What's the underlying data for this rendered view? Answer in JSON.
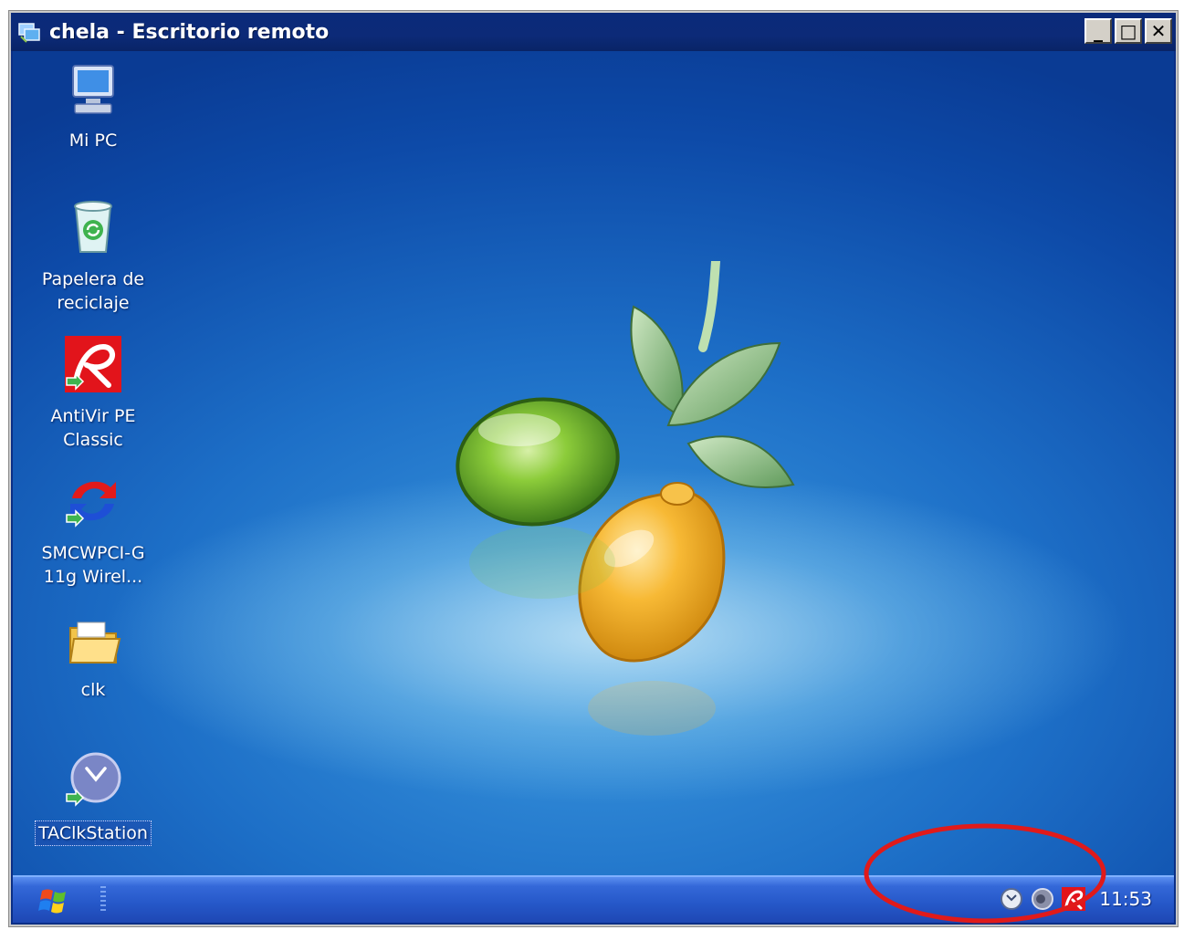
{
  "window": {
    "title": "chela - Escritorio remoto",
    "controls": {
      "minimize": "_",
      "maximize": "□",
      "close": "✕"
    }
  },
  "desktop": {
    "icons": [
      {
        "label_line1": "Mi PC",
        "label_line2": "",
        "icon": "my-computer-icon"
      },
      {
        "label_line1": "Papelera de",
        "label_line2": "reciclaje",
        "icon": "recycle-bin-icon"
      },
      {
        "label_line1": "AntiVir PE",
        "label_line2": "Classic",
        "icon": "antivir-icon"
      },
      {
        "label_line1": "SMCWPCI-G",
        "label_line2": "11g Wirel...",
        "icon": "wireless-adapter-icon"
      },
      {
        "label_line1": "clk",
        "label_line2": "",
        "icon": "folder-icon"
      },
      {
        "label_line1": "TAClkStation",
        "label_line2": "",
        "icon": "taclkstation-icon"
      }
    ],
    "wallpaper": "lemon-and-lime-wallpaper"
  },
  "taskbar": {
    "start_icon": "windows-logo-icon",
    "tray_icons": [
      "clock-service-icon",
      "speaker-icon",
      "antivir-tray-icon"
    ],
    "clock": "11:53"
  },
  "colors": {
    "titlebar": "#0a2a7a",
    "desktop": "#1d6fc7",
    "taskbar": "#2557c8",
    "annotation": "#e01a1a"
  }
}
